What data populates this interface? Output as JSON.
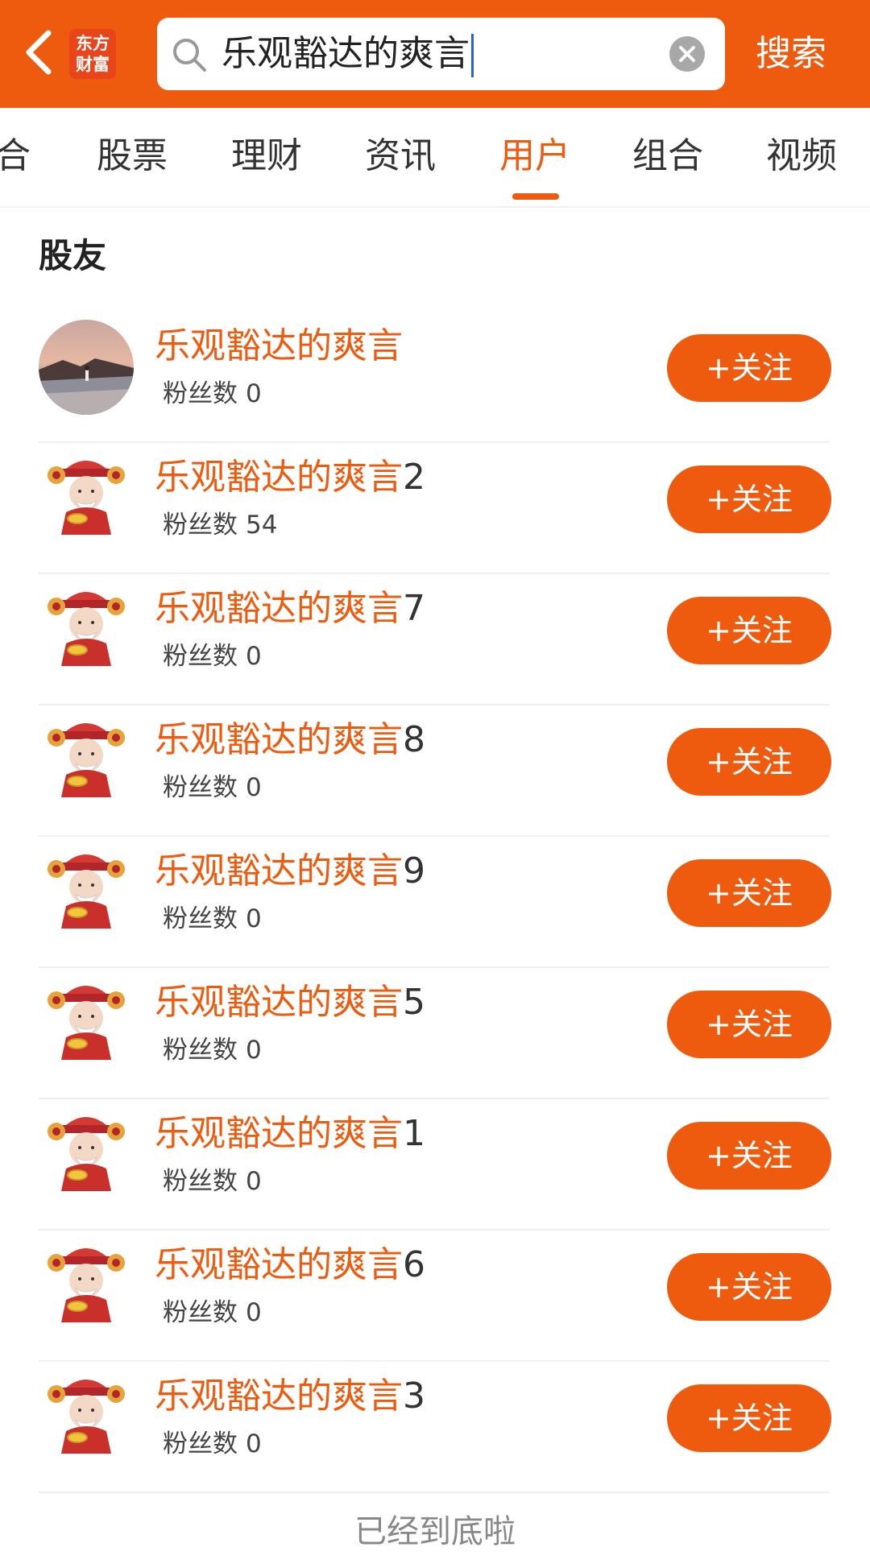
{
  "header": {
    "logo_line1": "东方",
    "logo_line2": "财富",
    "search_value": "乐观豁达的爽言",
    "search_button": "搜索",
    "colors": {
      "brand": "#ee5a0e",
      "logo_bg": "#e8451a"
    }
  },
  "tabs": [
    {
      "label": "合",
      "active": false
    },
    {
      "label": "股票",
      "active": false
    },
    {
      "label": "理财",
      "active": false
    },
    {
      "label": "资讯",
      "active": false
    },
    {
      "label": "用户",
      "active": true
    },
    {
      "label": "组合",
      "active": false
    },
    {
      "label": "视频",
      "active": false
    }
  ],
  "section_title": "股友",
  "fans_label": "粉丝数",
  "follow_label": "+关注",
  "users": [
    {
      "name": "乐观豁达的爽言",
      "suffix": "",
      "fans": "0",
      "avatar": "landscape-photo"
    },
    {
      "name": "乐观豁达的爽言",
      "suffix": "2",
      "fans": "54",
      "avatar": "fortune-god-icon"
    },
    {
      "name": "乐观豁达的爽言",
      "suffix": "7",
      "fans": "0",
      "avatar": "fortune-god-icon"
    },
    {
      "name": "乐观豁达的爽言",
      "suffix": "8",
      "fans": "0",
      "avatar": "fortune-god-icon"
    },
    {
      "name": "乐观豁达的爽言",
      "suffix": "9",
      "fans": "0",
      "avatar": "fortune-god-icon"
    },
    {
      "name": "乐观豁达的爽言",
      "suffix": "5",
      "fans": "0",
      "avatar": "fortune-god-icon"
    },
    {
      "name": "乐观豁达的爽言",
      "suffix": "1",
      "fans": "0",
      "avatar": "fortune-god-icon"
    },
    {
      "name": "乐观豁达的爽言",
      "suffix": "6",
      "fans": "0",
      "avatar": "fortune-god-icon"
    },
    {
      "name": "乐观豁达的爽言",
      "suffix": "3",
      "fans": "0",
      "avatar": "fortune-god-icon"
    }
  ],
  "end_text": "已经到底啦"
}
